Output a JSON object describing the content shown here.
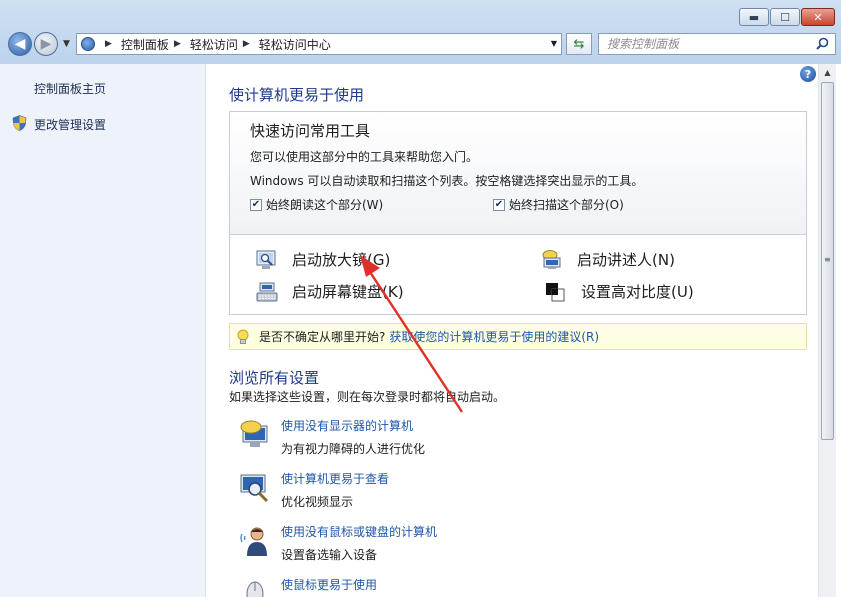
{
  "window": {
    "minimize_glyph": "▬",
    "maximize_glyph": "☐",
    "close_glyph": "✕"
  },
  "nav": {
    "breadcrumb": [
      "控制面板",
      "轻松访问",
      "轻松访问中心"
    ],
    "search_placeholder": "搜索控制面板"
  },
  "sidebar": {
    "items": [
      "控制面板主页",
      "更改管理设置"
    ]
  },
  "main": {
    "heading": "使计算机更易于使用",
    "quick": {
      "title": "快速访问常用工具",
      "desc1": "您可以使用这部分中的工具来帮助您入门。",
      "desc2": "Windows 可以自动读取和扫描这个列表。按空格键选择突出显示的工具。",
      "check_read": "始终朗读这个部分(W)",
      "check_scan": "始终扫描这个部分(O)",
      "check_read_on": true,
      "check_scan_on": true,
      "tools": [
        "启动放大镜(G)",
        "启动讲述人(N)",
        "启动屏幕键盘(K)",
        "设置高对比度(U)"
      ]
    },
    "tip": {
      "prefix": "是否不确定从哪里开始?",
      "link": "获取使您的计算机更易于使用的建议(R)"
    },
    "browse": {
      "heading": "浏览所有设置",
      "sub": "如果选择这些设置，则在每次登录时都将自动启动。",
      "items": [
        {
          "link": "使用没有显示器的计算机",
          "sub": "为有视力障碍的人进行优化"
        },
        {
          "link": "使计算机更易于查看",
          "sub": "优化视频显示"
        },
        {
          "link": "使用没有鼠标或键盘的计算机",
          "sub": "设置备选输入设备"
        },
        {
          "link": "使鼠标更易于使用",
          "sub": ""
        }
      ]
    }
  },
  "colors": {
    "link": "#1f57a8",
    "heading": "#1e3a8a",
    "tip_bg": "#fefee2",
    "arrow": "#e0302a"
  }
}
